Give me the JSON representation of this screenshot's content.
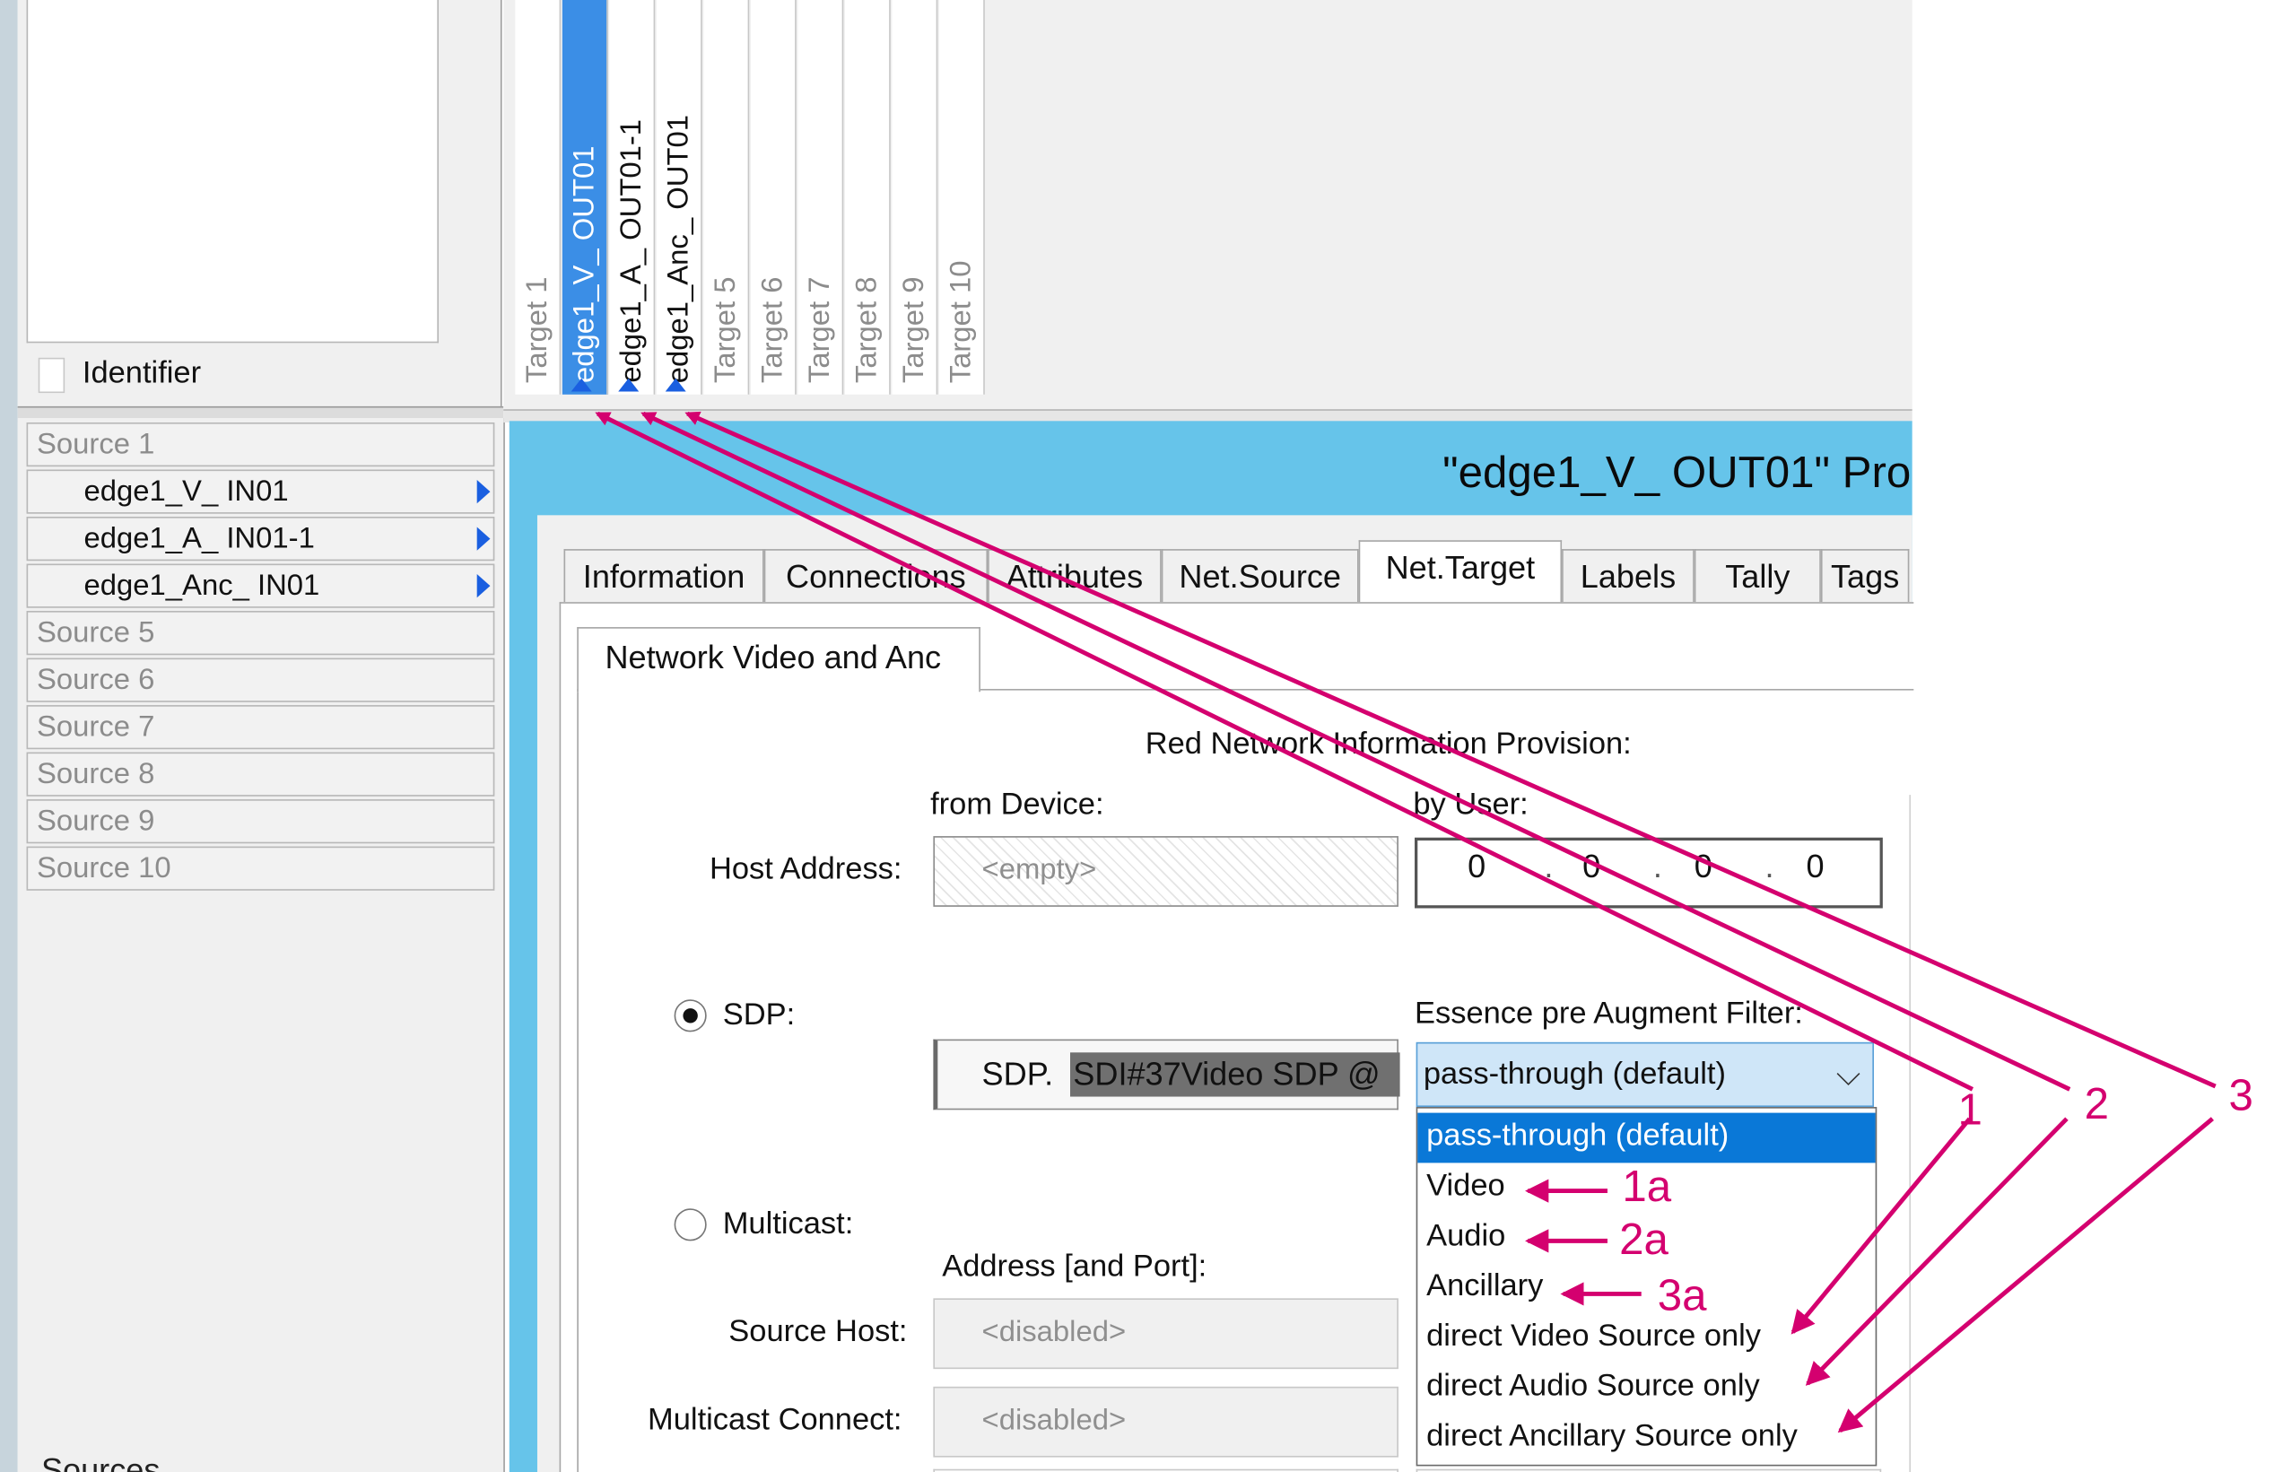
{
  "left_panel": {
    "identifier_label": "Identifier",
    "sources": [
      {
        "label": "Source 1",
        "active": false
      },
      {
        "label": "edge1_V_ IN01",
        "active": true
      },
      {
        "label": "edge1_A_ IN01-1",
        "active": true
      },
      {
        "label": "edge1_Anc_ IN01",
        "active": true
      },
      {
        "label": "Source 5",
        "active": false
      },
      {
        "label": "Source 6",
        "active": false
      },
      {
        "label": "Source 7",
        "active": false
      },
      {
        "label": "Source 8",
        "active": false
      },
      {
        "label": "Source 9",
        "active": false
      },
      {
        "label": "Source 10",
        "active": false
      }
    ],
    "footer_label": "Sources"
  },
  "targets": [
    {
      "label": "Target 1",
      "state": "dim"
    },
    {
      "label": "edge1_V_ OUT01",
      "state": "selected"
    },
    {
      "label": "edge1_A_ OUT01-1",
      "state": "active"
    },
    {
      "label": "edge1_Anc_ OUT01",
      "state": "active"
    },
    {
      "label": "Target 5",
      "state": "dim"
    },
    {
      "label": "Target 6",
      "state": "dim"
    },
    {
      "label": "Target 7",
      "state": "dim"
    },
    {
      "label": "Target 8",
      "state": "dim"
    },
    {
      "label": "Target 9",
      "state": "dim"
    },
    {
      "label": "Target 10",
      "state": "dim"
    }
  ],
  "properties": {
    "title": "\"edge1_V_ OUT01\" Pro",
    "tabs": [
      "Information",
      "Connections",
      "Attributes",
      "Net.Source",
      "Net.Target",
      "Labels",
      "Tally",
      "Tags"
    ],
    "selected_tab": "Net.Target",
    "subtab": "Network Video and Anc",
    "section_title": "Red Network Information Provision:",
    "from_device_label": "from Device:",
    "by_user_label": "by User:",
    "host_address_label": "Host Address:",
    "host_address_value": "<empty>",
    "ip_octets": [
      "0",
      "0",
      "0",
      "0"
    ],
    "sdp_label": "SDP:",
    "sdp_prefix": "SDP.",
    "sdp_value": "SDI#37Video SDP @",
    "essence_label": "Essence pre Augment Filter:",
    "combo_value": "pass-through (default)",
    "dropdown_options": [
      "pass-through (default)",
      "Video",
      "Audio",
      "Ancillary",
      "direct Video Source only",
      "direct Audio Source only",
      "direct Ancillary Source only"
    ],
    "multicast_label": "Multicast:",
    "address_port_label": "Address [and Port]:",
    "source_host_label": "Source Host:",
    "source_host_value": "<disabled>",
    "multicast_connect_label": "Multicast Connect:",
    "multicast_connect_value": "<disabled>"
  },
  "annotations": {
    "labels": [
      "1",
      "2",
      "3",
      "1a",
      "2a",
      "3a"
    ],
    "color": "#d4006f"
  }
}
